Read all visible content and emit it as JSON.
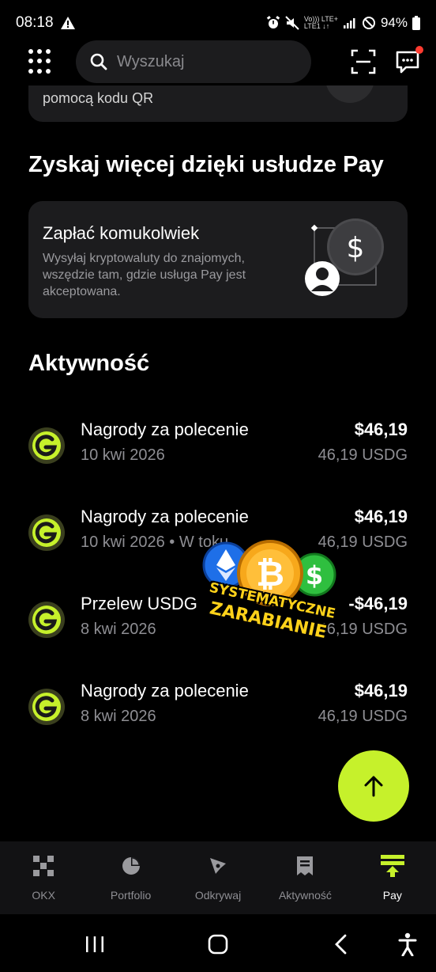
{
  "status_bar": {
    "time": "08:18",
    "network_line1": "Vo))) LTE+",
    "network_line2": "LTE1 ↓↑",
    "battery": "94%"
  },
  "search": {
    "placeholder": "Wyszukaj"
  },
  "qr_card": {
    "text_partial": "pomocą kodu QR"
  },
  "pay_section": {
    "title": "Zyskaj więcej dzięki usłudze Pay",
    "card": {
      "title": "Zapłać komukolwiek",
      "description": "Wysyłaj kryptowaluty do znajomych, wszędzie tam, gdzie usługa Pay jest akceptowana."
    }
  },
  "activity": {
    "title": "Aktywność",
    "items": [
      {
        "name": "Nagrody za polecenie",
        "date": "10 kwi 2026",
        "amount": "$46,19",
        "sub": "46,19 USDG"
      },
      {
        "name": "Nagrody za polecenie",
        "date": "10 kwi 2026 • W toku",
        "amount": "$46,19",
        "sub": "46,19 USDG"
      },
      {
        "name": "Przelew USDG",
        "date": "8 kwi 2026",
        "amount": "-$46,19",
        "sub": "46,19 USDG"
      },
      {
        "name": "Nagrody za polecenie",
        "date": "8 kwi 2026",
        "amount": "$46,19",
        "sub": "46,19 USDG"
      }
    ]
  },
  "sticker": {
    "line1": "SYSTEMATYCZNE",
    "line2": "ZARABIANIE"
  },
  "bottom_nav": [
    {
      "label": "OKX",
      "icon": "okx-logo-icon"
    },
    {
      "label": "Portfolio",
      "icon": "pie-chart-icon"
    },
    {
      "label": "Odkrywaj",
      "icon": "compass-icon"
    },
    {
      "label": "Aktywność",
      "icon": "receipt-icon"
    },
    {
      "label": "Pay",
      "icon": "pay-icon",
      "active": true
    }
  ],
  "colors": {
    "accent": "#c6f12b",
    "background": "#000000",
    "card": "#1c1c1e",
    "muted": "#8e8e93"
  }
}
